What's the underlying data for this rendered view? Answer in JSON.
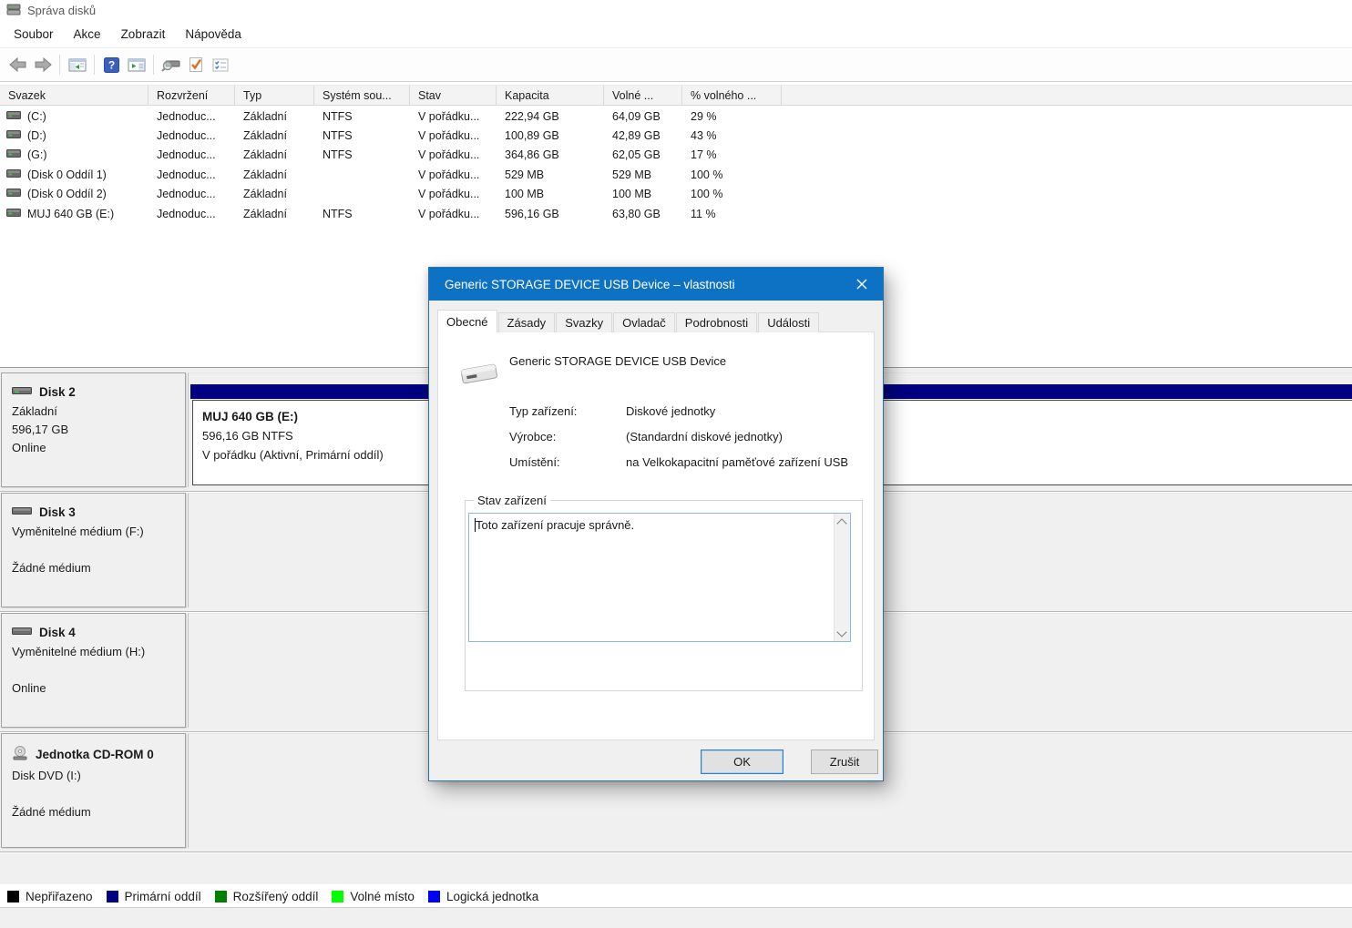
{
  "window": {
    "title": "Správa disků"
  },
  "menu": {
    "items": [
      "Soubor",
      "Akce",
      "Zobrazit",
      "Nápověda"
    ]
  },
  "toolbar": {
    "icons": [
      "back",
      "forward",
      "show-console-tree",
      "help",
      "show-action-pane",
      "disk-properties",
      "check-mark-document",
      "options-checklist"
    ]
  },
  "volume_table": {
    "columns": [
      "Svazek",
      "Rozvržení",
      "Typ",
      "Systém sou...",
      "Stav",
      "Kapacita",
      "Volné ...",
      "% volného ..."
    ],
    "rows": [
      {
        "svazek": "(C:)",
        "rozvrzeni": "Jednoduc...",
        "typ": "Základní",
        "system": "NTFS",
        "stav": "V pořádku...",
        "kapacita": "222,94 GB",
        "volne": "64,09 GB",
        "pct": "29 %"
      },
      {
        "svazek": "(D:)",
        "rozvrzeni": "Jednoduc...",
        "typ": "Základní",
        "system": "NTFS",
        "stav": "V pořádku...",
        "kapacita": "100,89 GB",
        "volne": "42,89 GB",
        "pct": "43 %"
      },
      {
        "svazek": "(G:)",
        "rozvrzeni": "Jednoduc...",
        "typ": "Základní",
        "system": "NTFS",
        "stav": "V pořádku...",
        "kapacita": "364,86 GB",
        "volne": "62,05 GB",
        "pct": "17 %"
      },
      {
        "svazek": "(Disk 0 Oddíl 1)",
        "rozvrzeni": "Jednoduc...",
        "typ": "Základní",
        "system": "",
        "stav": "V pořádku...",
        "kapacita": "529 MB",
        "volne": "529 MB",
        "pct": "100 %"
      },
      {
        "svazek": "(Disk 0 Oddíl 2)",
        "rozvrzeni": "Jednoduc...",
        "typ": "Základní",
        "system": "",
        "stav": "V pořádku...",
        "kapacita": "100 MB",
        "volne": "100 MB",
        "pct": "100 %"
      },
      {
        "svazek": "MUJ 640 GB (E:)",
        "rozvrzeni": "Jednoduc...",
        "typ": "Základní",
        "system": "NTFS",
        "stav": "V pořádku...",
        "kapacita": "596,16 GB",
        "volne": "63,80 GB",
        "pct": "11 %"
      }
    ]
  },
  "disks": [
    {
      "name": "Disk 2",
      "line1": "Základní",
      "line2": "596,17 GB",
      "line3": "Online"
    },
    {
      "name": "Disk 3",
      "line1": "Vyměnitelné médium (F:)",
      "line2": "",
      "line3": "Žádné médium"
    },
    {
      "name": "Disk 4",
      "line1": "Vyměnitelné médium (H:)",
      "line2": "",
      "line3": "Online"
    },
    {
      "name": "Jednotka CD-ROM 0",
      "line1": "Disk DVD (I:)",
      "line2": "",
      "line3": "Žádné médium"
    }
  ],
  "partition": {
    "title": "MUJ 640 GB  (E:)",
    "detail": "596,16 GB NTFS",
    "status": "V pořádku (Aktivní, Primární oddíl)",
    "color": "#000080"
  },
  "legend": [
    {
      "label": "Nepřiřazeno",
      "color": "#000000"
    },
    {
      "label": "Primární oddíl",
      "color": "#000080"
    },
    {
      "label": "Rozšířený oddíl",
      "color": "#008000"
    },
    {
      "label": "Volné místo",
      "color": "#00ff00"
    },
    {
      "label": "Logická jednotka",
      "color": "#0000ff"
    }
  ],
  "dialog": {
    "title": "Generic STORAGE DEVICE USB Device – vlastnosti",
    "accent": "#0e72c4",
    "tabs": [
      "Obecné",
      "Zásady",
      "Svazky",
      "Ovladač",
      "Podrobnosti",
      "Události"
    ],
    "device_name": "Generic STORAGE DEVICE USB Device",
    "fields": [
      {
        "label": "Typ zařízení:",
        "value": "Diskové jednotky"
      },
      {
        "label": "Výrobce:",
        "value": "(Standardní diskové jednotky)"
      },
      {
        "label": "Umístění:",
        "value": "na Velkokapacitní paměťové zařízení USB"
      }
    ],
    "group_title": "Stav zařízení",
    "status_text": "Toto zařízení pracuje správně.",
    "ok_label": "OK",
    "cancel_label": "Zrušit"
  }
}
